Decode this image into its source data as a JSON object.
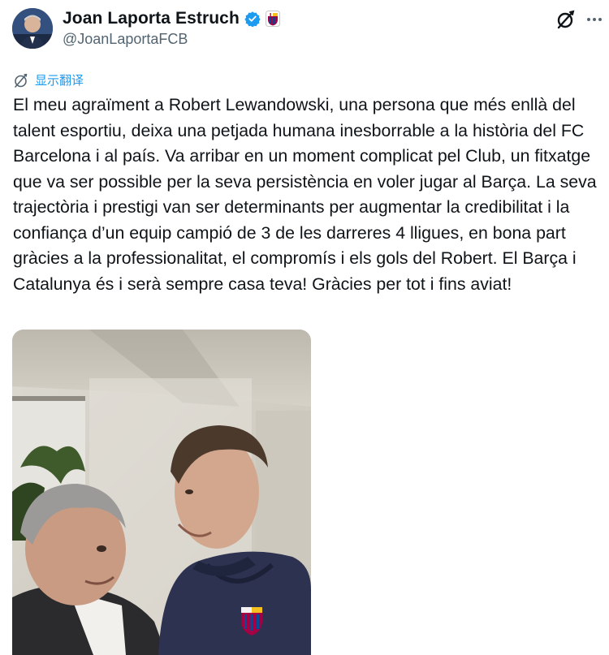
{
  "author": {
    "display_name": "Joan Laporta Estruch",
    "handle": "@JoanLaportaFCB"
  },
  "translate": {
    "label": "显示翻译"
  },
  "tweet": {
    "text": "El meu agraïment a Robert Lewandowski, una persona que més enllà del talent esportiu, deixa una petjada humana inesborrable a la història del FC Barcelona i al país. Va arribar en un moment complicat pel Club, un fitxatge que va ser possible per la seva persistència en voler jugar al Barça. La seva trajectòria i prestigi van ser determinants per augmentar la credibilitat i la confiança d’un equip campió de 3 de les darreres 4 lligues, en bona part gràcies a la professionalitat, el compromís i els gols del Robert. El Barça i Catalunya és i serà sempre casa teva! Gràcies per tot i fins aviat!"
  },
  "icons": [
    "verified-badge-icon",
    "fcb-crest-icon",
    "grok-icon",
    "more-icon",
    "translate-icon"
  ],
  "colors": {
    "accent": "#1d9bf0",
    "text": "#0f1419",
    "secondary": "#536471"
  }
}
